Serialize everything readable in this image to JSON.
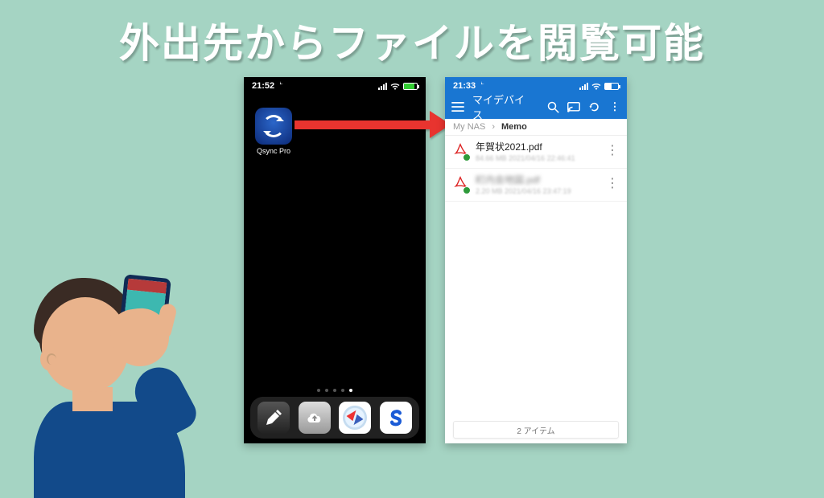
{
  "heading": "外出先からファイルを閲覧可能",
  "left_phone": {
    "time": "21:52",
    "app_name": "Qsync Pro"
  },
  "right_phone": {
    "time": "21:33",
    "appbar_title": "マイデバイス",
    "breadcrumb_root": "My NAS",
    "breadcrumb_current": "Memo",
    "files": [
      {
        "name": "年賀状2021.pdf",
        "meta": "84.66 MB  2021/04/16 22:46:41"
      },
      {
        "name": "町内会地図.pdf",
        "meta": "2.20 MB  2021/04/16 23:47:19"
      }
    ],
    "item_count_label": "2 アイテム"
  }
}
